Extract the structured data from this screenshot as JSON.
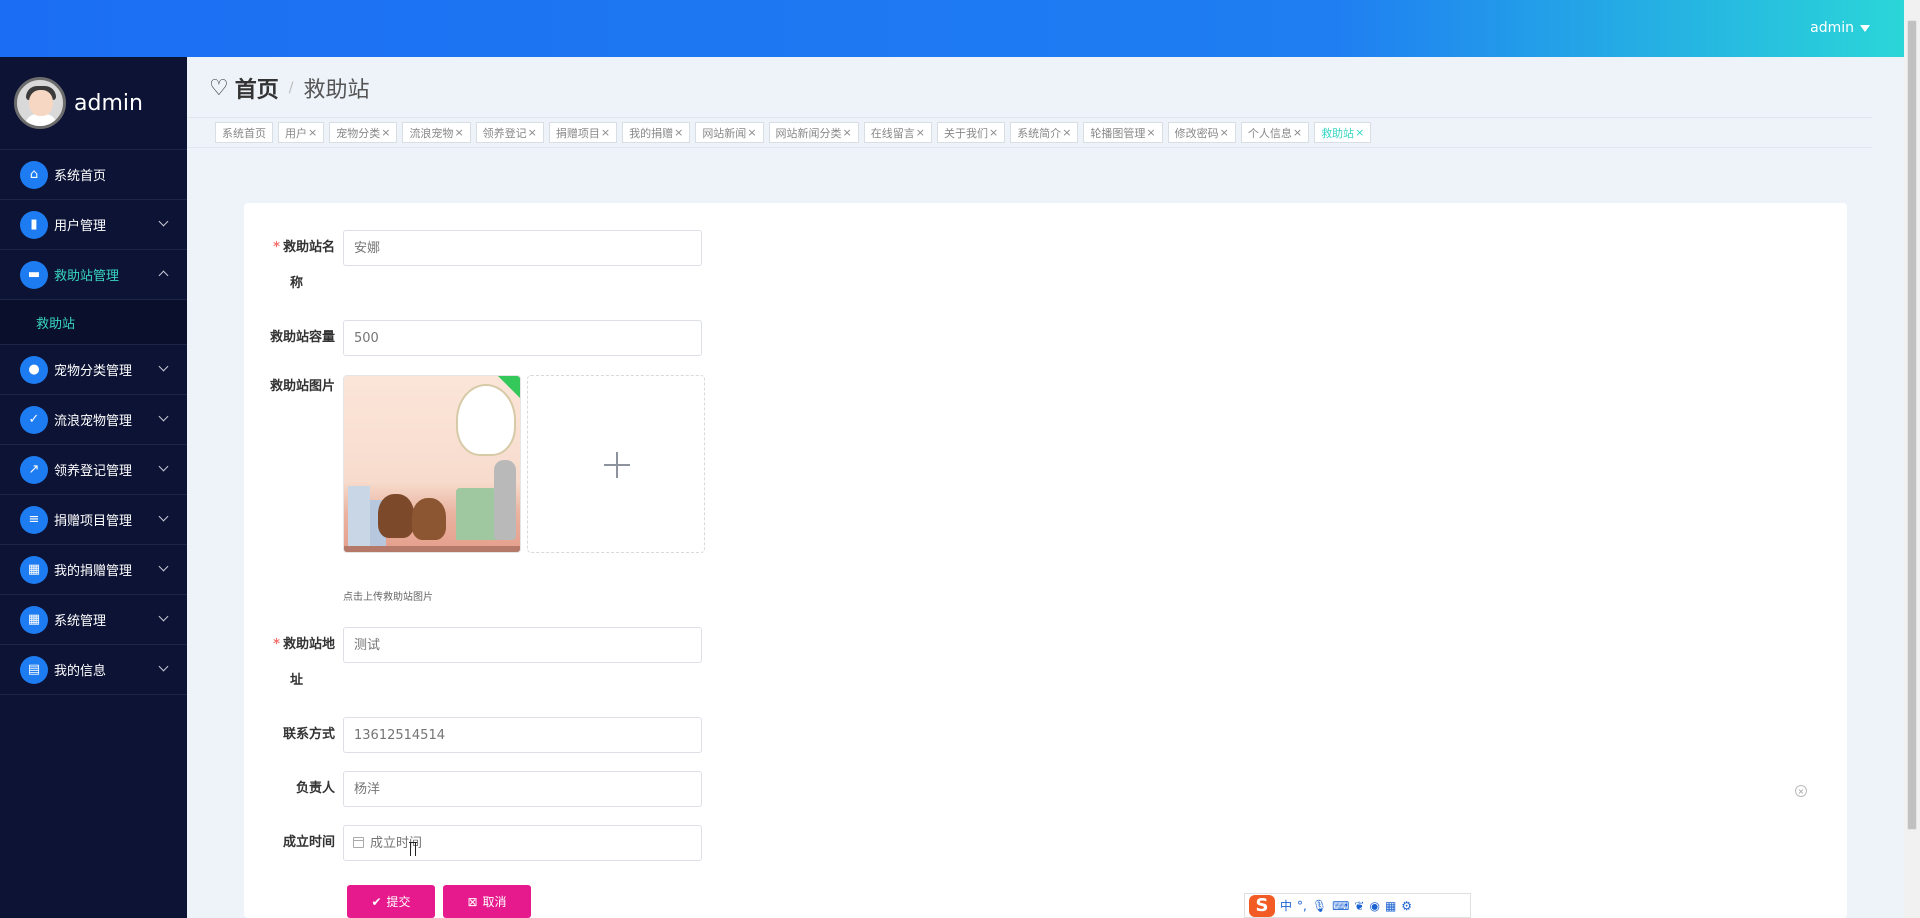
{
  "topbar": {
    "user": "admin"
  },
  "sidebar": {
    "username": "admin",
    "items": [
      {
        "label": "系统首页",
        "icon": "home-icon"
      },
      {
        "label": "用户管理",
        "icon": "users-icon"
      },
      {
        "label": "救助站管理",
        "icon": "briefcase-icon",
        "active": true,
        "sub": [
          "救助站"
        ]
      },
      {
        "label": "宠物分类管理",
        "icon": "person-icon"
      },
      {
        "label": "流浪宠物管理",
        "icon": "clipboard-icon"
      },
      {
        "label": "领养登记管理",
        "icon": "chart-icon"
      },
      {
        "label": "捐赠项目管理",
        "icon": "document-icon"
      },
      {
        "label": "我的捐赠管理",
        "icon": "grid-icon"
      },
      {
        "label": "系统管理",
        "icon": "grid-icon"
      },
      {
        "label": "我的信息",
        "icon": "card-icon"
      }
    ]
  },
  "breadcrumb": {
    "home": "首页",
    "sep": "/",
    "current": "救助站"
  },
  "tags": [
    {
      "label": "系统首页",
      "closable": false
    },
    {
      "label": "用户",
      "closable": true
    },
    {
      "label": "宠物分类",
      "closable": true
    },
    {
      "label": "流浪宠物",
      "closable": true
    },
    {
      "label": "领养登记",
      "closable": true
    },
    {
      "label": "捐赠项目",
      "closable": true
    },
    {
      "label": "我的捐赠",
      "closable": true
    },
    {
      "label": "网站新闻",
      "closable": true
    },
    {
      "label": "网站新闻分类",
      "closable": true
    },
    {
      "label": "在线留言",
      "closable": true
    },
    {
      "label": "关于我们",
      "closable": true
    },
    {
      "label": "系统简介",
      "closable": true
    },
    {
      "label": "轮播图管理",
      "closable": true
    },
    {
      "label": "修改密码",
      "closable": true
    },
    {
      "label": "个人信息",
      "closable": true
    },
    {
      "label": "救助站",
      "closable": true,
      "active": true
    }
  ],
  "form": {
    "name": {
      "label_line1": "救助站名",
      "label_line2": "称",
      "placeholder": "安娜"
    },
    "capacity": {
      "label": "救助站容量",
      "placeholder": "500"
    },
    "image": {
      "label": "救助站图片",
      "hint": "点击上传救助站图片"
    },
    "address": {
      "label_line1": "救助站地",
      "label_line2": "址",
      "placeholder": "测试"
    },
    "contact": {
      "label": "联系方式",
      "placeholder": "13612514514"
    },
    "manager": {
      "label": "负责人",
      "placeholder": "杨洋"
    },
    "founded": {
      "label": "成立时间",
      "placeholder": "成立时间"
    },
    "submit": "提交",
    "cancel": "取消"
  },
  "ime": {
    "mode": "中",
    "punct": "°,"
  },
  "colors": {
    "topbar": "#1b6ef3",
    "sidebar": "#0d1335",
    "accent": "#38d6c2",
    "button": "#e6198d"
  }
}
